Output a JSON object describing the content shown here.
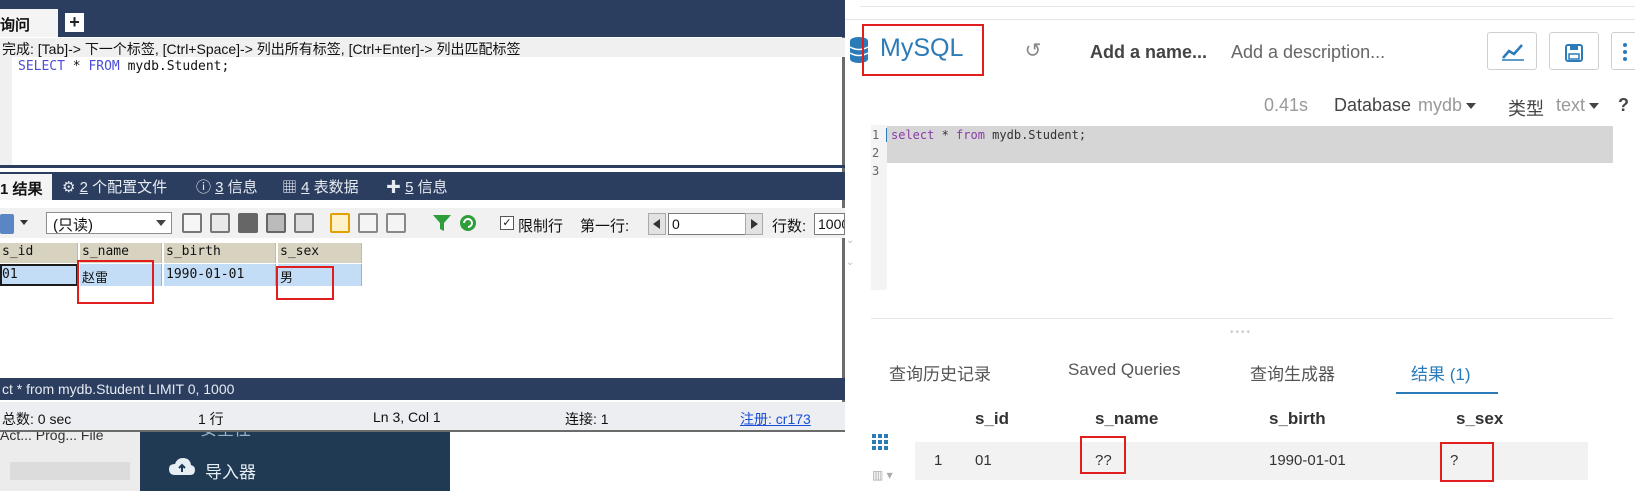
{
  "hue": {
    "title": "MySQL",
    "add_name": "Add a name...",
    "add_description": "Add a description...",
    "exec_time": "0.41s",
    "database_label": "Database",
    "database_value": "mydb",
    "type_label": "类型",
    "type_value": "text",
    "help": "?",
    "editor_lines": [
      "1",
      "2",
      "3"
    ],
    "query": {
      "kw1": "select",
      "mid1": " * ",
      "kw2": "from",
      "rest": " mydb.Student;"
    },
    "tabs": [
      "查询历史记录",
      "Saved Queries",
      "查询生成器",
      "结果 (1)"
    ],
    "result_columns": [
      "s_id",
      "s_name",
      "s_birth",
      "s_sex"
    ],
    "result_row": {
      "index": "1",
      "s_id": "01",
      "s_name": "??",
      "s_birth": "1990-01-01",
      "s_sex": "?"
    },
    "sidebar_item": "导入器",
    "sidebar_peek": "安全性",
    "accent_color": "#2b7bb9",
    "highlight_color": "#e01e1e"
  },
  "sqlyog": {
    "query_tab": "询问",
    "plus": "+",
    "hint": "完成: [Tab]-> 下一个标签, [Ctrl+Space]-> 列出所有标签, [Ctrl+Enter]-> 列出匹配标签",
    "sql": {
      "kw1": "SELECT",
      "star": " * ",
      "kw2": "FROM",
      "rest": " mydb.Student;"
    },
    "result_tabs": [
      {
        "num": "1",
        "label": " 结果"
      },
      {
        "num": "2",
        "label": " 个配置文件"
      },
      {
        "num": "3",
        "label": " 信息"
      },
      {
        "num": "4",
        "label": " 表数据"
      },
      {
        "num": "5",
        "label": " 信息"
      }
    ],
    "readonly": "(只读)",
    "limit_check": "✓",
    "limit_label": "限制行",
    "first_row_label": "第一行:",
    "first_row_value": "0",
    "rows_label": "行数:",
    "rows_value": "1000",
    "columns": [
      "s_id",
      "s_name",
      "s_birth",
      "s_sex"
    ],
    "row": {
      "s_id": "01",
      "s_name": "赵雷",
      "s_birth": "1990-01-01",
      "s_sex": "男"
    },
    "status_sql": "ct * from mydb.Student LIMIT 0, 1000",
    "total": "总数: 0 sec",
    "rows_count": "1 行",
    "position": "Ln 3, Col 1",
    "connections": "连接: 1",
    "register": "注册: cr173"
  },
  "underneath": {
    "text": "Act... Prog... File"
  }
}
